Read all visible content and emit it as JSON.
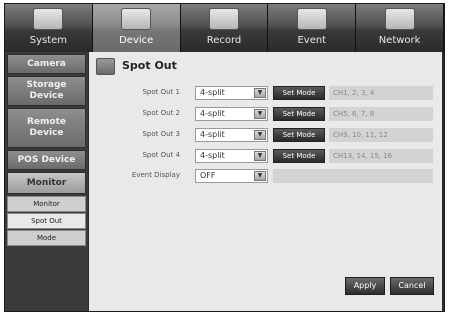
{
  "tabs": [
    {
      "label": "System",
      "icon": "monitor-icon",
      "active": false
    },
    {
      "label": "Device",
      "icon": "camera-icon",
      "active": true
    },
    {
      "label": "Record",
      "icon": "record-icon",
      "active": false
    },
    {
      "label": "Event",
      "icon": "event-icon",
      "active": false
    },
    {
      "label": "Network",
      "icon": "network-icon",
      "active": false
    }
  ],
  "sidebar": {
    "items": [
      {
        "label": "Camera"
      },
      {
        "label": "Storage\nDevice"
      },
      {
        "label": "Remote\nDevice"
      },
      {
        "label": "POS Device"
      },
      {
        "label": "Monitor"
      }
    ],
    "subitems": [
      {
        "label": "Monitor"
      },
      {
        "label": "Spot Out"
      },
      {
        "label": "Mode"
      }
    ]
  },
  "page": {
    "title": "Spot Out"
  },
  "spot_rows": [
    {
      "label": "Spot Out 1",
      "value": "4-split",
      "button": "Set Mode",
      "channels": "CH1, 2, 3, 4"
    },
    {
      "label": "Spot Out 2",
      "value": "4-split",
      "button": "Set Mode",
      "channels": "CH5, 6, 7, 8"
    },
    {
      "label": "Spot Out 3",
      "value": "4-split",
      "button": "Set Mode",
      "channels": "CH9, 10, 11, 12"
    },
    {
      "label": "Spot Out 4",
      "value": "4-split",
      "button": "Set Mode",
      "channels": "CH13, 14, 15, 16"
    }
  ],
  "event_display": {
    "label": "Event Display",
    "value": "OFF"
  },
  "buttons": {
    "apply": "Apply",
    "cancel": "Cancel"
  }
}
